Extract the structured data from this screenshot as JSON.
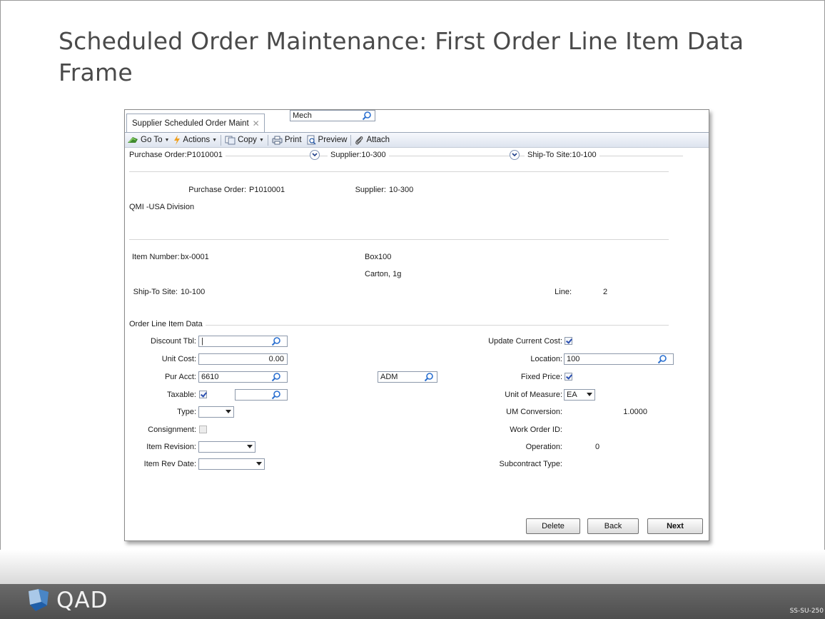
{
  "slide": {
    "title": "Scheduled Order Maintenance: First Order Line Item Data Frame",
    "logo_text": "QAD",
    "slide_id": "SS-SU-250"
  },
  "window": {
    "tab_label": "Supplier Scheduled Order Maint",
    "toolbar": {
      "goto": "Go To",
      "actions": "Actions",
      "copy": "Copy",
      "print": "Print",
      "preview": "Preview",
      "attach": "Attach"
    },
    "header": {
      "po": "Purchase Order:P1010001",
      "supplier": "Supplier:10-300",
      "shipto": "Ship-To Site:10-100"
    },
    "order_info": {
      "po_label": "Purchase Order:",
      "po_value": "P1010001",
      "supplier_label": "Supplier:",
      "supplier_value": "10-300",
      "division": "QMI -USA Division"
    },
    "item_info": {
      "item_label": "Item Number:",
      "item_value": "bx-0001",
      "desc1": "Box100",
      "desc2": "Carton, 1g",
      "site_label": "Ship-To Site:",
      "site_value": "10-100",
      "line_label": "Line:",
      "line_value": "2"
    },
    "section_title": "Order Line Item Data",
    "left_fields": {
      "discount_label": "Discount Tbl:",
      "discount_value": "|",
      "unit_cost_label": "Unit Cost:",
      "unit_cost_value": "0.00",
      "pur_acct_label": "Pur Acct:",
      "pur_acct_value": "6610",
      "sub_acct_value": "Mech",
      "cc_value": "ADM",
      "taxable_label": "Taxable:",
      "taxable_checked": true,
      "tax_code_value": "",
      "type_label": "Type:",
      "type_value": "",
      "consignment_label": "Consignment:",
      "consignment_checked": false,
      "item_rev_label": "Item Revision:",
      "item_rev_value": "",
      "item_rev_date_label": "Item Rev Date:",
      "item_rev_date_value": ""
    },
    "right_fields": {
      "update_cost_label": "Update Current Cost:",
      "update_cost_checked": true,
      "location_label": "Location:",
      "location_value": "100",
      "fixed_price_label": "Fixed Price:",
      "fixed_price_checked": true,
      "um_label": "Unit of Measure:",
      "um_value": "EA",
      "um_conv_label": "UM Conversion:",
      "um_conv_value": "1.0000",
      "wo_id_label": "Work Order ID:",
      "wo_id_value": "",
      "operation_label": "Operation:",
      "operation_value": "0",
      "subcontract_label": "Subcontract Type:",
      "subcontract_value": ""
    },
    "buttons": {
      "delete": "Delete",
      "back": "Back",
      "next": "Next"
    }
  },
  "colors": {
    "title_text": "#4a4a4a",
    "footer_bg": "#5a5a5a",
    "toolbar_bg": "#dde4ef",
    "check_mark": "#2a4fb0"
  }
}
